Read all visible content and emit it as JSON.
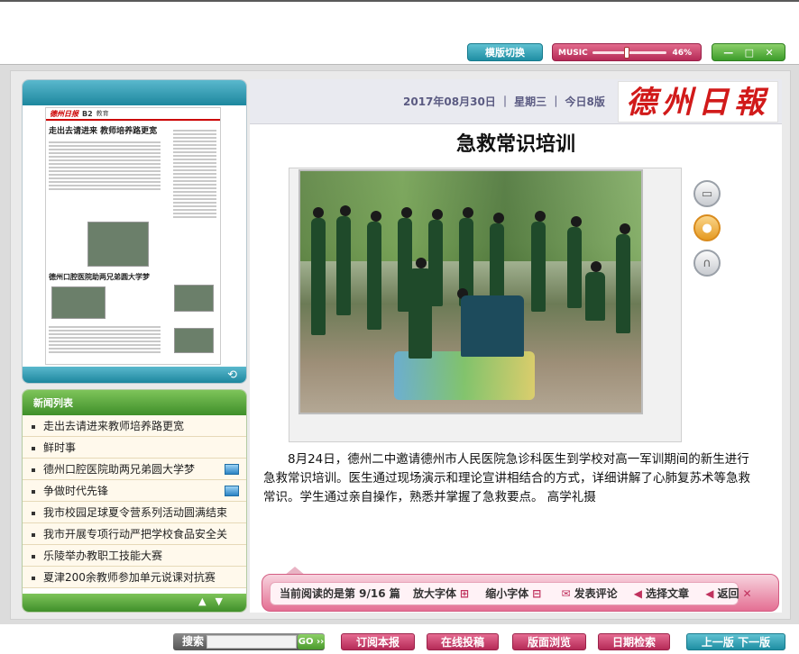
{
  "top_controls": {
    "template_switch": "模版切换",
    "music_label": "MUSIC",
    "music_volume_percent": 46,
    "music_volume_text": "46%",
    "window_buttons": [
      "—",
      "□",
      "✕"
    ]
  },
  "thumbnail": {
    "logo": "德州日报",
    "page_code": "B2",
    "section": "教育",
    "headline": "走出去请进来 教师培养路更宽",
    "headline2": "德州口腔医院助两兄弟圆大学梦",
    "rotate_icon": "rotate-icon"
  },
  "news_list": {
    "title": "新闻列表",
    "items": [
      {
        "label": "走出去请进来教师培养路更宽",
        "has_pic": false
      },
      {
        "label": "鲜时事",
        "has_pic": false
      },
      {
        "label": "德州口腔医院助两兄弟圆大学梦",
        "has_pic": true
      },
      {
        "label": "争做时代先锋",
        "has_pic": true
      },
      {
        "label": "我市校园足球夏令营系列活动圆满结束",
        "has_pic": false
      },
      {
        "label": "我市开展专项行动严把学校食品安全关",
        "has_pic": false
      },
      {
        "label": "乐陵举办教职工技能大赛",
        "has_pic": false
      },
      {
        "label": "夏津200余教师参加单元说课对抗赛",
        "has_pic": false
      }
    ],
    "up_icon": "▲",
    "down_icon": "▼"
  },
  "article": {
    "date_line": "2017年08月30日 ｜ 星期三 ｜ 今日8版",
    "newspaper_logo": "德州日報",
    "title": "急救常识培训",
    "body": "8月24日，德州二中邀请德州市人民医院急诊科医生到学校对高一军训期间的新生进行急救常识培训。医生通过现场演示和理论宣讲相结合的方式，详细讲解了心肺复苏术等急救常识。学生通过亲自操作，熟悉并掌握了急救要点。 高学礼摄",
    "side_icons": [
      "video-icon",
      "person-icon",
      "headphones-icon"
    ]
  },
  "read_bar": {
    "current": "当前阅读的是第  9/16  篇",
    "enlarge": "放大字体",
    "shrink": "缩小字体",
    "comment": "发表评论",
    "select": "选择文章",
    "back": "返回"
  },
  "footer": {
    "search_label": "搜索",
    "search_placeholder": "",
    "go": "GO ››",
    "subscribe": "订阅本报",
    "submit": "在线投稿",
    "browse": "版面浏览",
    "date_search": "日期检索",
    "prev_next": "上一版   下一版"
  }
}
